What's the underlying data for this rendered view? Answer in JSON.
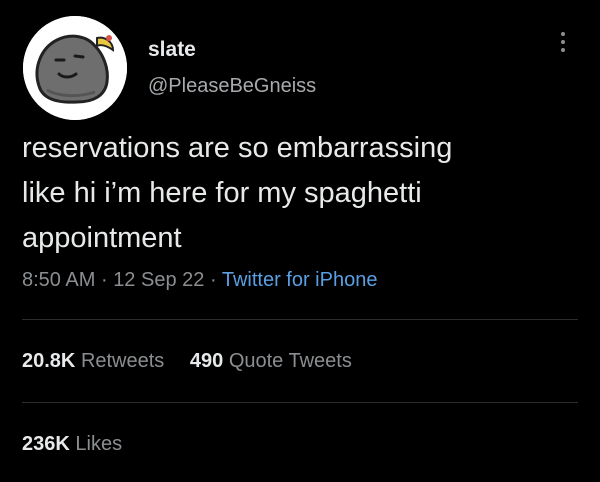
{
  "tweet": {
    "author": {
      "display_name": "slate",
      "handle": "@PleaseBeGneiss"
    },
    "text": "reservations are so embarrassing\nlike hi i’m here for my spaghetti\nappointment",
    "time": "8:50 AM",
    "date": "12 Sep 22",
    "source": "Twitter for iPhone",
    "separator": "·",
    "stats": {
      "retweets": {
        "count": "20.8K",
        "label": "Retweets"
      },
      "quote_tweets": {
        "count": "490",
        "label": "Quote Tweets"
      },
      "likes": {
        "count": "236K",
        "label": "Likes"
      }
    }
  },
  "icons": {
    "avatar": "rock-character-avatar",
    "more": "more-options-icon"
  },
  "colors": {
    "background": "#000000",
    "primary_text": "#e7e9ea",
    "secondary_text": "#8b8e91",
    "link": "#5b9fe3",
    "divider": "#2b2e31"
  }
}
